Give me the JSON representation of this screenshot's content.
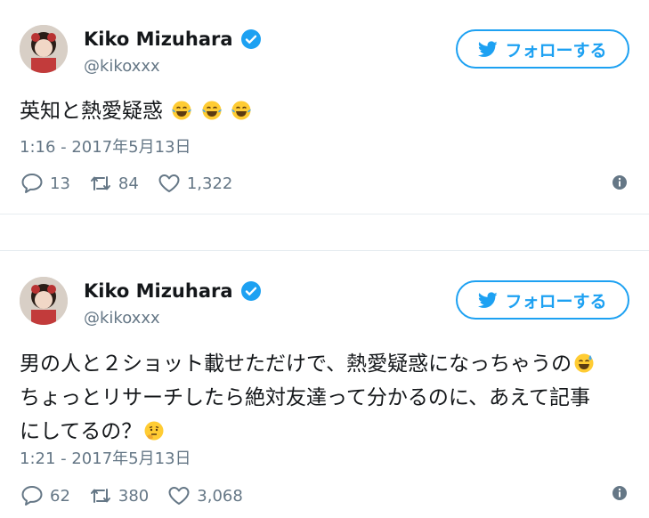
{
  "tweets": [
    {
      "display_name": "Kiko Mizuhara",
      "handle": "@kikoxxx",
      "follow_label": "フォローする",
      "text_lines": [
        "英知と熱愛疑惑"
      ],
      "emojis": [
        "face-with-tears-of-joy",
        "face-with-tears-of-joy",
        "face-with-tears-of-joy"
      ],
      "timestamp": "1:16 - 2017年5月13日",
      "replies": "13",
      "retweets": "84",
      "likes": "1,322"
    },
    {
      "display_name": "Kiko Mizuhara",
      "handle": "@kikoxxx",
      "follow_label": "フォローする",
      "text_lines": [
        "男の人と２ショット載せただけで、熱愛疑惑になっちゃうの",
        "ちょっとリサーチしたら絶対友達って分かるのに、あえて記事",
        "にしてるの？"
      ],
      "emojis": [
        "grinning-face-with-sweat",
        "thinking-face"
      ],
      "timestamp": "1:21 - 2017年5月13日",
      "replies": "62",
      "retweets": "380",
      "likes": "3,068"
    }
  ],
  "colors": {
    "accent": "#1da1f2",
    "muted": "#657786",
    "text": "#14171a",
    "divider": "#e6ecf0"
  }
}
